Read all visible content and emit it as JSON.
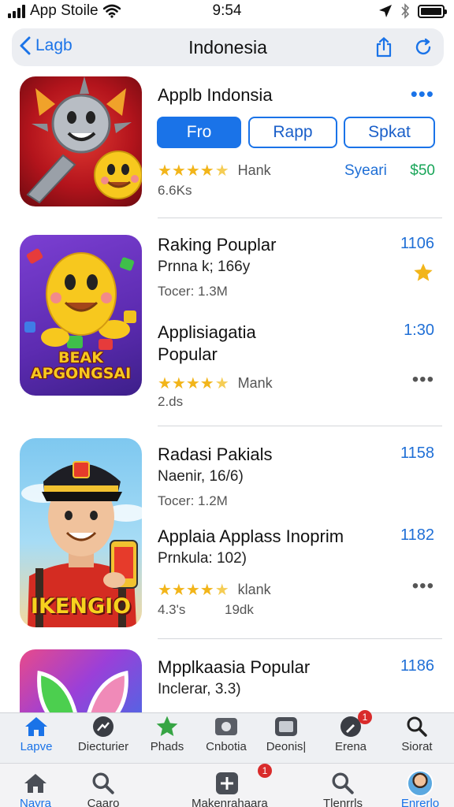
{
  "status_bar": {
    "carrier": "App Stoile",
    "time": "9:54"
  },
  "nav": {
    "back_label": "Lagb",
    "title": "Indonesia"
  },
  "featured": {
    "title": "Applb Indonsia",
    "segments": [
      "Fro",
      "Rapp",
      "Spkat"
    ],
    "rating_label": "Hank",
    "link_label": "Syeari",
    "price": "$50",
    "size": "6.6Ks"
  },
  "list": [
    {
      "entries": [
        {
          "title": "Raking Pouplar",
          "subtitle": "Prnna k; 166y",
          "meta": "Tocer: 1.3M",
          "number": "1106"
        },
        {
          "title_lines": [
            "Applisiagatia",
            "Popular"
          ],
          "rating_label": "Mank",
          "meta": "2.ds",
          "number": "1:30"
        }
      ],
      "icon_caption": [
        "BEAK",
        "APGONGSAI"
      ]
    },
    {
      "entries": [
        {
          "title": "Radasi Pakials",
          "subtitle": "Naenir, 16/6)",
          "meta": "Tocer: 1.2M",
          "number": "1158"
        },
        {
          "title": "Applaia Applass Inoprim",
          "subtitle": "Prnkula: 102)",
          "rating_label": "klank",
          "meta_left": "4.3's",
          "meta_right": "19dk",
          "number": "1182"
        }
      ],
      "icon_caption": "IKENGIO"
    },
    {
      "entries": [
        {
          "title": "Mpplkaasia Popular",
          "subtitle": "Inclerar, 3.3)",
          "number": "1186"
        }
      ]
    }
  ],
  "tabbar_top": [
    {
      "label": "Lapve",
      "icon": "home-icon",
      "active": true
    },
    {
      "label": "Diecturier",
      "icon": "trending-icon"
    },
    {
      "label": "Phads",
      "icon": "star-icon"
    },
    {
      "label": "Cnbotia",
      "icon": "box-icon"
    },
    {
      "label": "Deonis|",
      "icon": "photo-icon"
    },
    {
      "label": "Erena",
      "icon": "pen-icon",
      "badge": "1"
    },
    {
      "label": "Siorat",
      "icon": "search-icon"
    }
  ],
  "tabbar_bottom": [
    {
      "label": "Nayra",
      "icon": "home-icon",
      "active": true
    },
    {
      "label": "Caaro",
      "icon": "search-icon"
    },
    {
      "label": "Makenrahaara",
      "icon": "add-icon",
      "badge": "1"
    },
    {
      "label": "Tlenrrls",
      "icon": "search-icon"
    },
    {
      "label": "Enrerlo",
      "icon": "avatar",
      "active": true
    }
  ],
  "colors": {
    "accent": "#1a73e8",
    "star": "#f2b51a",
    "price": "#18a558",
    "badge": "#d92b2b"
  }
}
